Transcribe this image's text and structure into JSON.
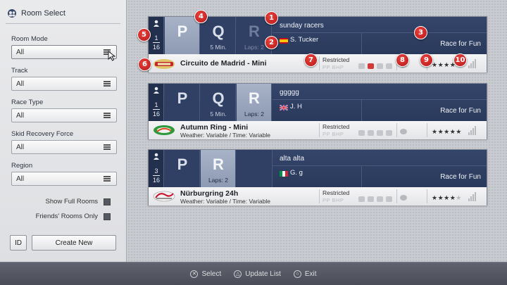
{
  "sidebar": {
    "title": "Room Select",
    "room_mode": {
      "label": "Room Mode",
      "value": "All"
    },
    "track": {
      "label": "Track",
      "value": "All"
    },
    "race_type": {
      "label": "Race Type",
      "value": "All"
    },
    "skid_recovery": {
      "label": "Skid Recovery Force",
      "value": "All"
    },
    "region": {
      "label": "Region",
      "value": "All"
    },
    "show_full_rooms": "Show Full Rooms",
    "friends_only": "Friends' Rooms Only",
    "id_button": "ID",
    "create_new": "Create New"
  },
  "rooms": [
    {
      "count_top": "1",
      "count_bottom": "16",
      "sessions": [
        {
          "letter": "P",
          "sub": ""
        },
        {
          "letter": "Q",
          "sub": "5 Min."
        },
        {
          "letter": "R",
          "sub": "Laps: 2"
        }
      ],
      "name": "sunday racers",
      "host": "S. Tucker",
      "race_type": "Race for Fun",
      "track": "Circuito de Madrid - Mini",
      "track_sub": "",
      "restricted": "Restricted",
      "pp_bhp": "PP BHP",
      "stars": "★★★★",
      "stars_off": ""
    },
    {
      "count_top": "1",
      "count_bottom": "16",
      "sessions": [
        {
          "letter": "P",
          "sub": ""
        },
        {
          "letter": "Q",
          "sub": "5 Min."
        },
        {
          "letter": "R",
          "sub": "Laps: 2"
        }
      ],
      "name": "ggggg",
      "host": "J. H",
      "race_type": "Race for Fun",
      "track": "Autumn Ring - Mini",
      "track_sub": "Weather: Variable / Time: Variable",
      "restricted": "Restricted",
      "pp_bhp": "PP BHP",
      "stars": "★★★★★",
      "stars_off": ""
    },
    {
      "count_top": "3",
      "count_bottom": "16",
      "sessions": [
        {
          "letter": "P",
          "sub": ""
        },
        {
          "letter": "R",
          "sub": "Laps: 2"
        }
      ],
      "name": "alta alta",
      "host": "G. g",
      "race_type": "Race for Fun",
      "track": "Nürburgring 24h",
      "track_sub": "Weather: Variable / Time: Variable",
      "restricted": "Restricted",
      "pp_bhp": "PP BHP",
      "stars": "★★★★",
      "stars_off": "★"
    }
  ],
  "markers": [
    "1",
    "2",
    "3",
    "4",
    "5",
    "6",
    "7",
    "8",
    "9",
    "10"
  ],
  "footer": {
    "select_label": "Select",
    "update_label": "Update List",
    "exit_label": "Exit",
    "select_glyph": "✕",
    "update_glyph": "△",
    "exit_glyph": "○"
  },
  "colors": {
    "accent": "#2a3a5c",
    "marker": "#d62a27",
    "highlight": "#98a4bb"
  }
}
